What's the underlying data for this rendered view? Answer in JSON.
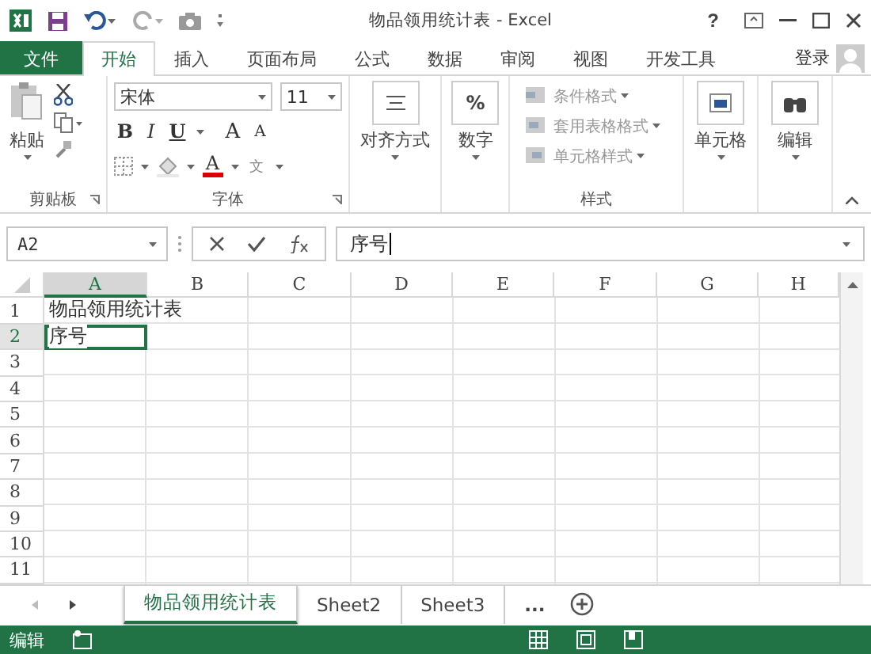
{
  "title_bar": {
    "title": "物品领用统计表 - Excel",
    "help": "?"
  },
  "tabs": [
    {
      "label": "文件",
      "kind": "file",
      "selected": false
    },
    {
      "label": "开始",
      "kind": "tab",
      "selected": true
    },
    {
      "label": "插入",
      "kind": "tab",
      "selected": false
    },
    {
      "label": "页面布局",
      "kind": "tab",
      "selected": false
    },
    {
      "label": "公式",
      "kind": "tab",
      "selected": false
    },
    {
      "label": "数据",
      "kind": "tab",
      "selected": false
    },
    {
      "label": "审阅",
      "kind": "tab",
      "selected": false
    },
    {
      "label": "视图",
      "kind": "tab",
      "selected": false
    },
    {
      "label": "开发工具",
      "kind": "tab",
      "selected": false
    }
  ],
  "account": "登录",
  "ribbon": {
    "clipboard": {
      "paste": "粘贴",
      "label": "剪贴板"
    },
    "font": {
      "name": "宋体",
      "size": "11",
      "bold": "B",
      "italic": "I",
      "underline": "U",
      "grow": "A",
      "shrink": "A",
      "font_color_letter": "A",
      "phonetic": "文",
      "label": "字体"
    },
    "alignment": {
      "label": "对齐方式"
    },
    "number": {
      "symbol": "%",
      "label": "数字"
    },
    "styles": {
      "items": [
        "条件格式",
        "套用表格格式",
        "单元格样式"
      ],
      "label": "样式"
    },
    "cells": {
      "label": "单元格"
    },
    "editing": {
      "label": "编辑"
    }
  },
  "formula_bar": {
    "name_box": "A2",
    "formula": "序号"
  },
  "grid": {
    "columns": [
      {
        "label": "A",
        "selected": true
      },
      {
        "label": "B",
        "selected": false
      },
      {
        "label": "C",
        "selected": false
      },
      {
        "label": "D",
        "selected": false
      },
      {
        "label": "E",
        "selected": false
      },
      {
        "label": "F",
        "selected": false
      },
      {
        "label": "G",
        "selected": false
      },
      {
        "label": "H",
        "selected": false
      }
    ],
    "rows": [
      {
        "label": "1",
        "selected": false,
        "cells": [
          "物品领用统计表"
        ]
      },
      {
        "label": "2",
        "selected": true,
        "cells": [
          "序号"
        ]
      },
      {
        "label": "3",
        "selected": false,
        "cells": []
      },
      {
        "label": "4",
        "selected": false,
        "cells": []
      },
      {
        "label": "5",
        "selected": false,
        "cells": []
      },
      {
        "label": "6",
        "selected": false,
        "cells": []
      },
      {
        "label": "7",
        "selected": false,
        "cells": []
      },
      {
        "label": "8",
        "selected": false,
        "cells": []
      },
      {
        "label": "9",
        "selected": false,
        "cells": []
      },
      {
        "label": "10",
        "selected": false,
        "cells": []
      },
      {
        "label": "11",
        "selected": false,
        "cells": []
      }
    ]
  },
  "sheet_tabs": [
    {
      "label": "物品领用统计表",
      "selected": true
    },
    {
      "label": "Sheet2",
      "selected": false
    },
    {
      "label": "Sheet3",
      "selected": false
    }
  ],
  "more_sheets": "...",
  "status_bar": {
    "mode": "编辑"
  }
}
